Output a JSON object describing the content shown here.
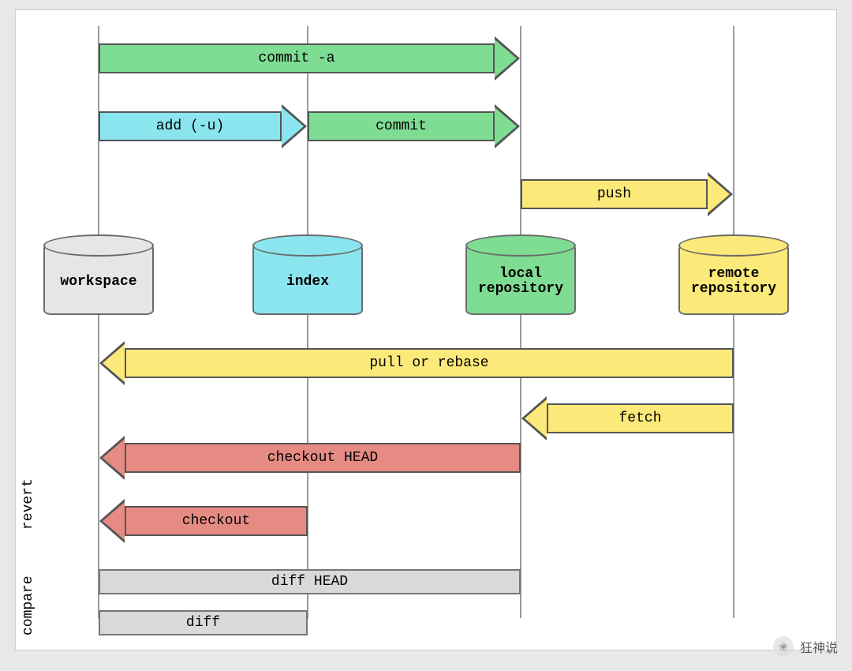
{
  "areas": {
    "workspace": {
      "label": "workspace",
      "color": "#e6e6e6"
    },
    "index": {
      "label": "index",
      "color": "#8be5ef"
    },
    "local": {
      "label": "local repository",
      "color": "#7fdc93"
    },
    "remote": {
      "label": "remote repository",
      "color": "#fbe97a"
    }
  },
  "arrows": {
    "commit_a": {
      "label": "commit -a",
      "from": "workspace",
      "to": "local",
      "dir": "right",
      "color": "green"
    },
    "add": {
      "label": "add (-u)",
      "from": "workspace",
      "to": "index",
      "dir": "right",
      "color": "cyan"
    },
    "commit": {
      "label": "commit",
      "from": "index",
      "to": "local",
      "dir": "right",
      "color": "green"
    },
    "push": {
      "label": "push",
      "from": "local",
      "to": "remote",
      "dir": "right",
      "color": "yellow"
    },
    "pull": {
      "label": "pull or rebase",
      "from": "remote",
      "to": "workspace",
      "dir": "left",
      "color": "yellow"
    },
    "fetch": {
      "label": "fetch",
      "from": "remote",
      "to": "local",
      "dir": "left",
      "color": "yellow"
    },
    "checkout_head": {
      "label": "checkout HEAD",
      "from": "local",
      "to": "workspace",
      "dir": "left",
      "color": "red"
    },
    "checkout": {
      "label": "checkout",
      "from": "index",
      "to": "workspace",
      "dir": "left",
      "color": "red"
    }
  },
  "bars": {
    "diff_head": {
      "label": "diff HEAD",
      "span": [
        "workspace",
        "local"
      ]
    },
    "diff": {
      "label": "diff",
      "span": [
        "workspace",
        "index"
      ]
    }
  },
  "sections": {
    "revert": "revert",
    "compare": "compare"
  },
  "watermark": {
    "icon": "❀",
    "text": "狂神说"
  }
}
